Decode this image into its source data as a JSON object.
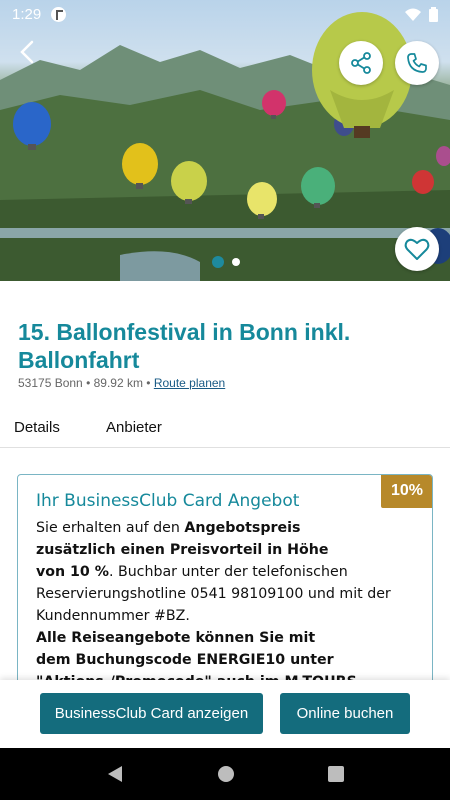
{
  "status": {
    "time": "1:29"
  },
  "hero": {
    "image_alt": "Hot air balloons over Bonn",
    "slide_count": 2,
    "active_slide": 1
  },
  "title": "15. Ballonfestival in Bonn inkl. Ballonfahrt",
  "meta": {
    "location": "53175 Bonn • 89.92 km • ",
    "route_link": "Route planen"
  },
  "tabs": [
    {
      "label": "Details"
    },
    {
      "label": "Anbieter"
    }
  ],
  "offer": {
    "badge": "10%",
    "title": "Ihr BusinessClub Card Angebot",
    "line1_a": "Sie erhalten auf den ",
    "line1_b": "Angebotspreis",
    "line2": "zusätzlich einen Preisvorteil in Höhe",
    "line3_a": "von 10 %",
    "line3_b": ". Buchbar unter der telefonischen",
    "line4": "Reservierungshotline 0541 98109100 und mit der",
    "line5": "Kundennummer #BZ.",
    "line6": "Alle Reiseangebote können Sie mit",
    "line7": "dem Buchungscode ENERGIE10 unter",
    "line8": "\"Aktions-/Promocode\" auch im M-TOURS"
  },
  "buttons": {
    "card": "BusinessClub Card anzeigen",
    "book": "Online buchen"
  },
  "colors": {
    "accent": "#16899b",
    "button": "#146c7d",
    "badge": "#b7892a",
    "link": "#1a5b86"
  }
}
